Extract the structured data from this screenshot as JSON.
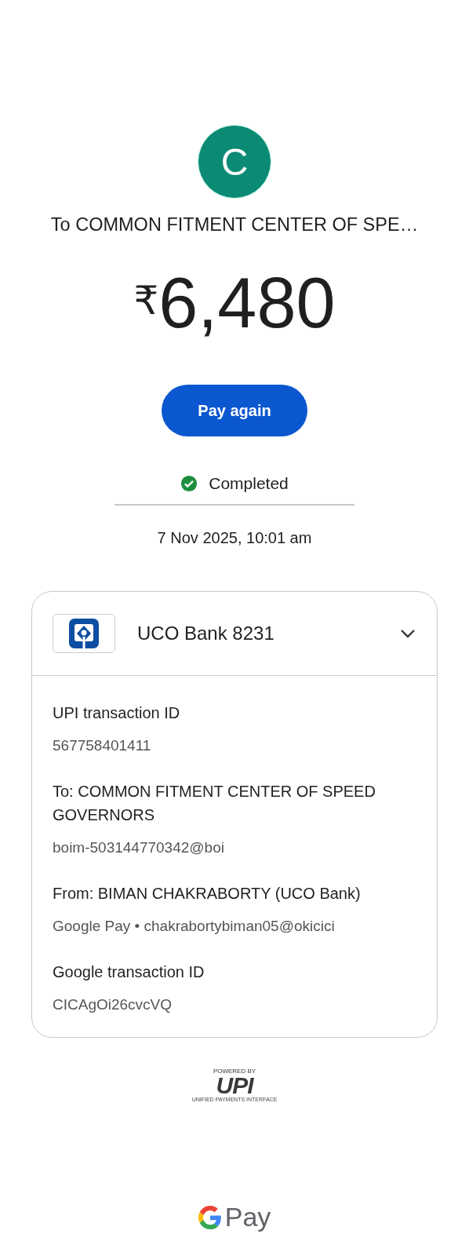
{
  "payee": {
    "initial": "C",
    "title": "To COMMON FITMENT CENTER OF SPE…"
  },
  "amount": {
    "currency": "₹",
    "value": "6,480"
  },
  "pay_again": "Pay again",
  "status": {
    "label": "Completed",
    "completed": true
  },
  "date": "7 Nov 2025, 10:01 am",
  "card": {
    "bank": "UCO Bank 8231",
    "expanded": true,
    "details": [
      {
        "label": "UPI transaction ID",
        "value": "567758401411"
      },
      {
        "label": "To: COMMON FITMENT CENTER OF SPEED GOVERNORS",
        "value": "boim-503144770342@boi"
      },
      {
        "label": "From: BIMAN CHAKRABORTY (UCO Bank)",
        "value": "Google Pay • chakrabortybiman05@okicici"
      },
      {
        "label": "Google transaction ID",
        "value": "CICAgOi26cvcVQ"
      }
    ]
  },
  "upi_logo": {
    "powered_by": "POWERED BY",
    "mark": "UPI",
    "tagline": "UNIFIED PAYMENTS INTERFACE"
  },
  "footer": {
    "brand": "Pay"
  }
}
